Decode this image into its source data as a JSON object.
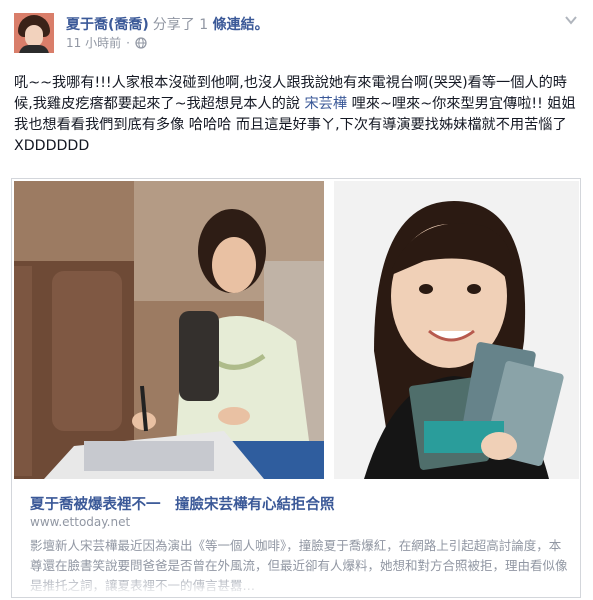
{
  "post": {
    "author": "夏于喬(喬喬)",
    "action": "分享了",
    "count": "1",
    "action_suffix": "條連結。",
    "time": "11 小時前",
    "privacy_icon": "globe-icon",
    "menu_icon": "chevron-down-icon"
  },
  "message": {
    "part1": "吼~~我哪有!!!人家根本沒碰到他啊,也沒人跟我說她有來電視台啊(哭哭)看等一個人的時候,我雞皮疙瘩都要起來了~我超想見本人的說 ",
    "tag": "宋芸樺",
    "part2": " 哩來~哩來~你來型男宜傳啦!! 姐姐我也想看看我們到底有多像 哈哈哈 而且這是好事ㄚ,下次有導演要找姊妹檔就不用苦惱了XDDDDDD"
  },
  "attachment": {
    "title": "夏于喬被爆表裡不一　撞臉宋芸樺有心結拒合照",
    "domain": "www.ettoday.net",
    "description": "影壇新人宋芸樺最近因為演出《等一個人咖啡》，撞臉夏于喬爆紅，在網路上引起超高討論度，本尊還在臉書笑說要問爸爸是否曾在外風流，但最近卻有人爆料，她想和對方合照被拒，理由看似像是推托之詞，讓夏表裡不一的傳言甚囂…"
  },
  "colors": {
    "link": "#3b5998",
    "muted": "#9197a3",
    "border": "#d3d6db"
  }
}
